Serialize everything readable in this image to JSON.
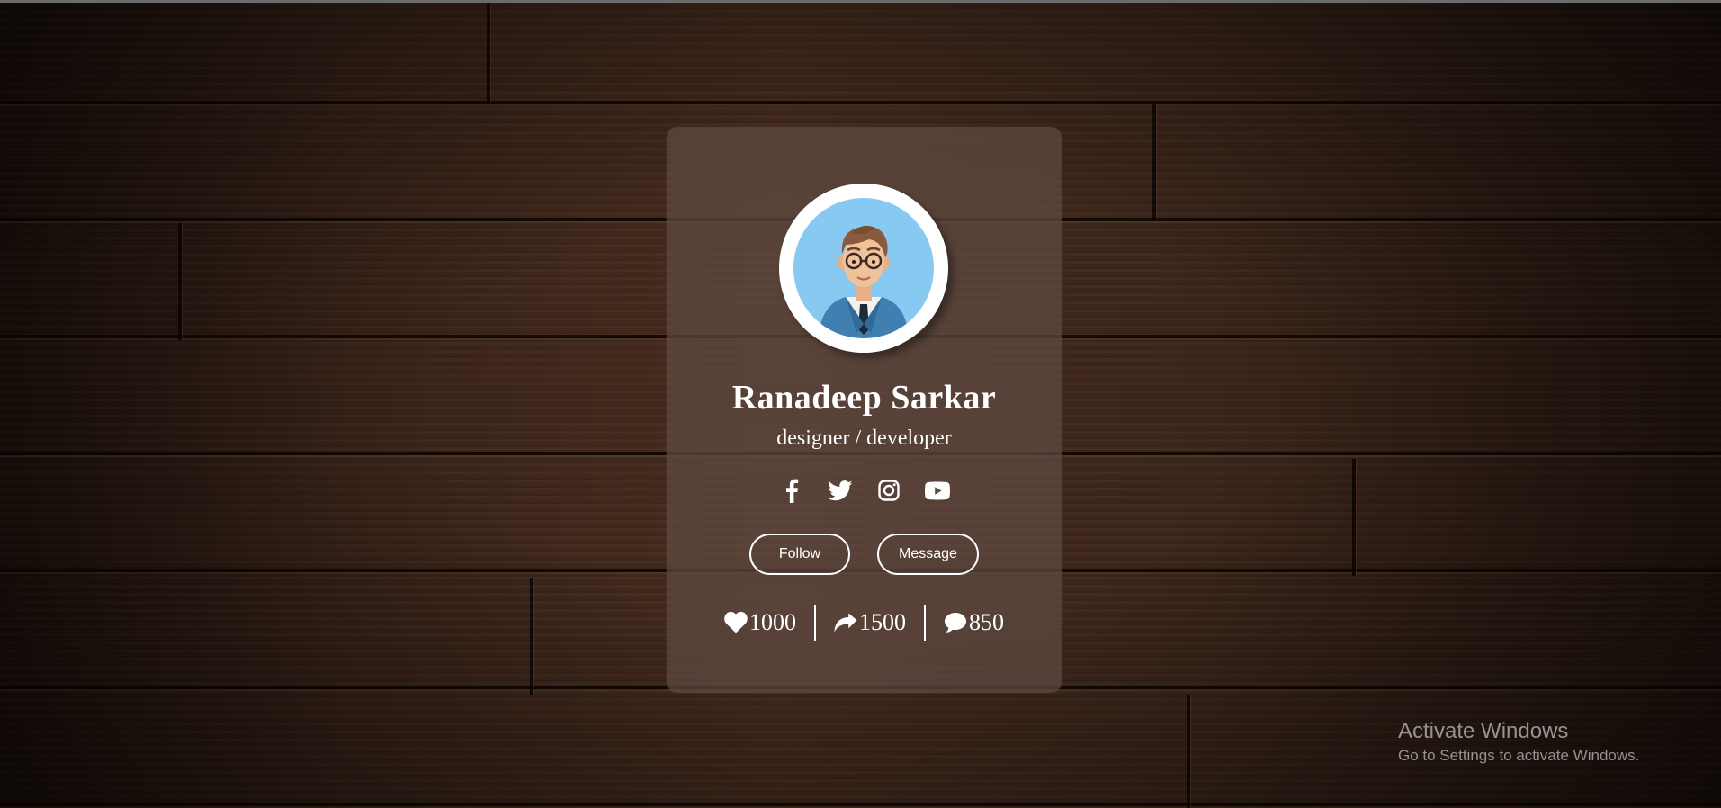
{
  "profile": {
    "name": "Ranadeep Sarkar",
    "role": "designer / developer",
    "avatar_icon": "developer-avatar-icon"
  },
  "socials": [
    {
      "icon": "facebook-icon"
    },
    {
      "icon": "twitter-icon"
    },
    {
      "icon": "instagram-icon"
    },
    {
      "icon": "youtube-icon"
    }
  ],
  "actions": {
    "follow_label": "Follow",
    "message_label": "Message"
  },
  "stats": {
    "likes": "1000",
    "shares": "1500",
    "comments": "850"
  },
  "watermark": {
    "title": "Activate Windows",
    "subtitle": "Go to Settings to activate Windows."
  },
  "colors": {
    "card_background": "#5f4b42",
    "text": "#ffffff",
    "avatar_background": "#87c9f0"
  }
}
